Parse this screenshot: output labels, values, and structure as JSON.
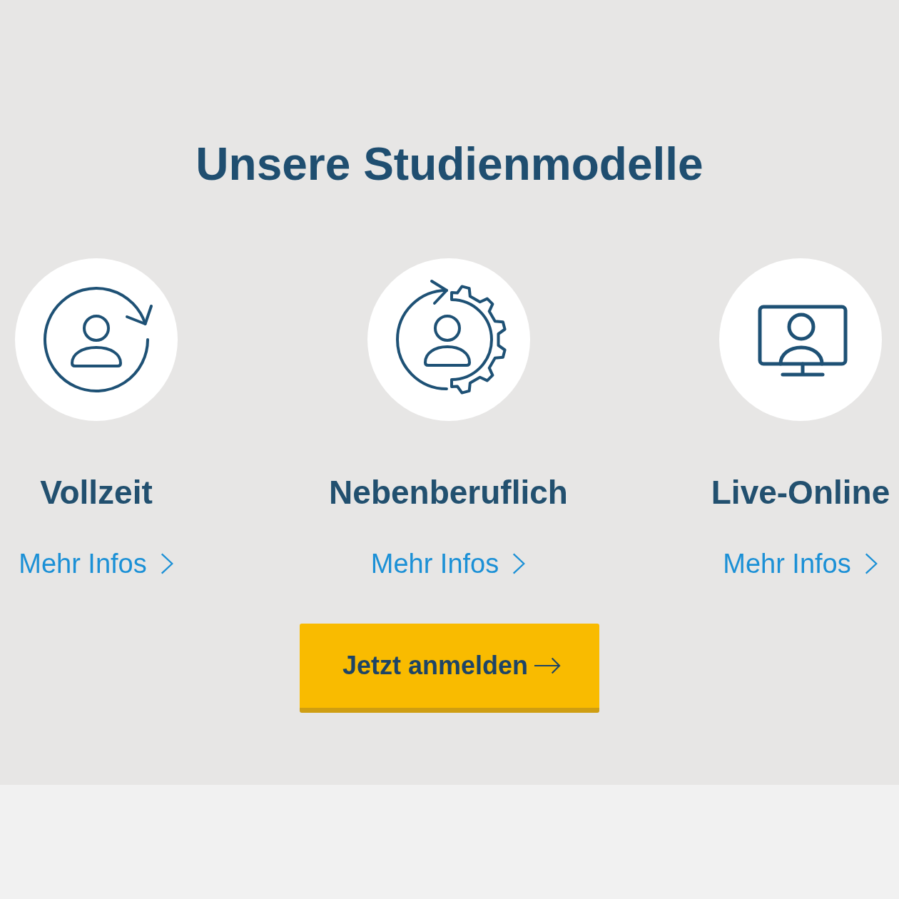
{
  "heading": "Unsere Studienmodelle",
  "models": [
    {
      "kind": "cycle",
      "title": "Vollzeit",
      "link": "Mehr Infos"
    },
    {
      "kind": "cycle-gear",
      "title": "Nebenberuflich",
      "link": "Mehr Infos"
    },
    {
      "kind": "monitor",
      "title": "Live-Online",
      "link": "Mehr Infos"
    }
  ],
  "cta": {
    "label": "Jetzt anmelden"
  }
}
